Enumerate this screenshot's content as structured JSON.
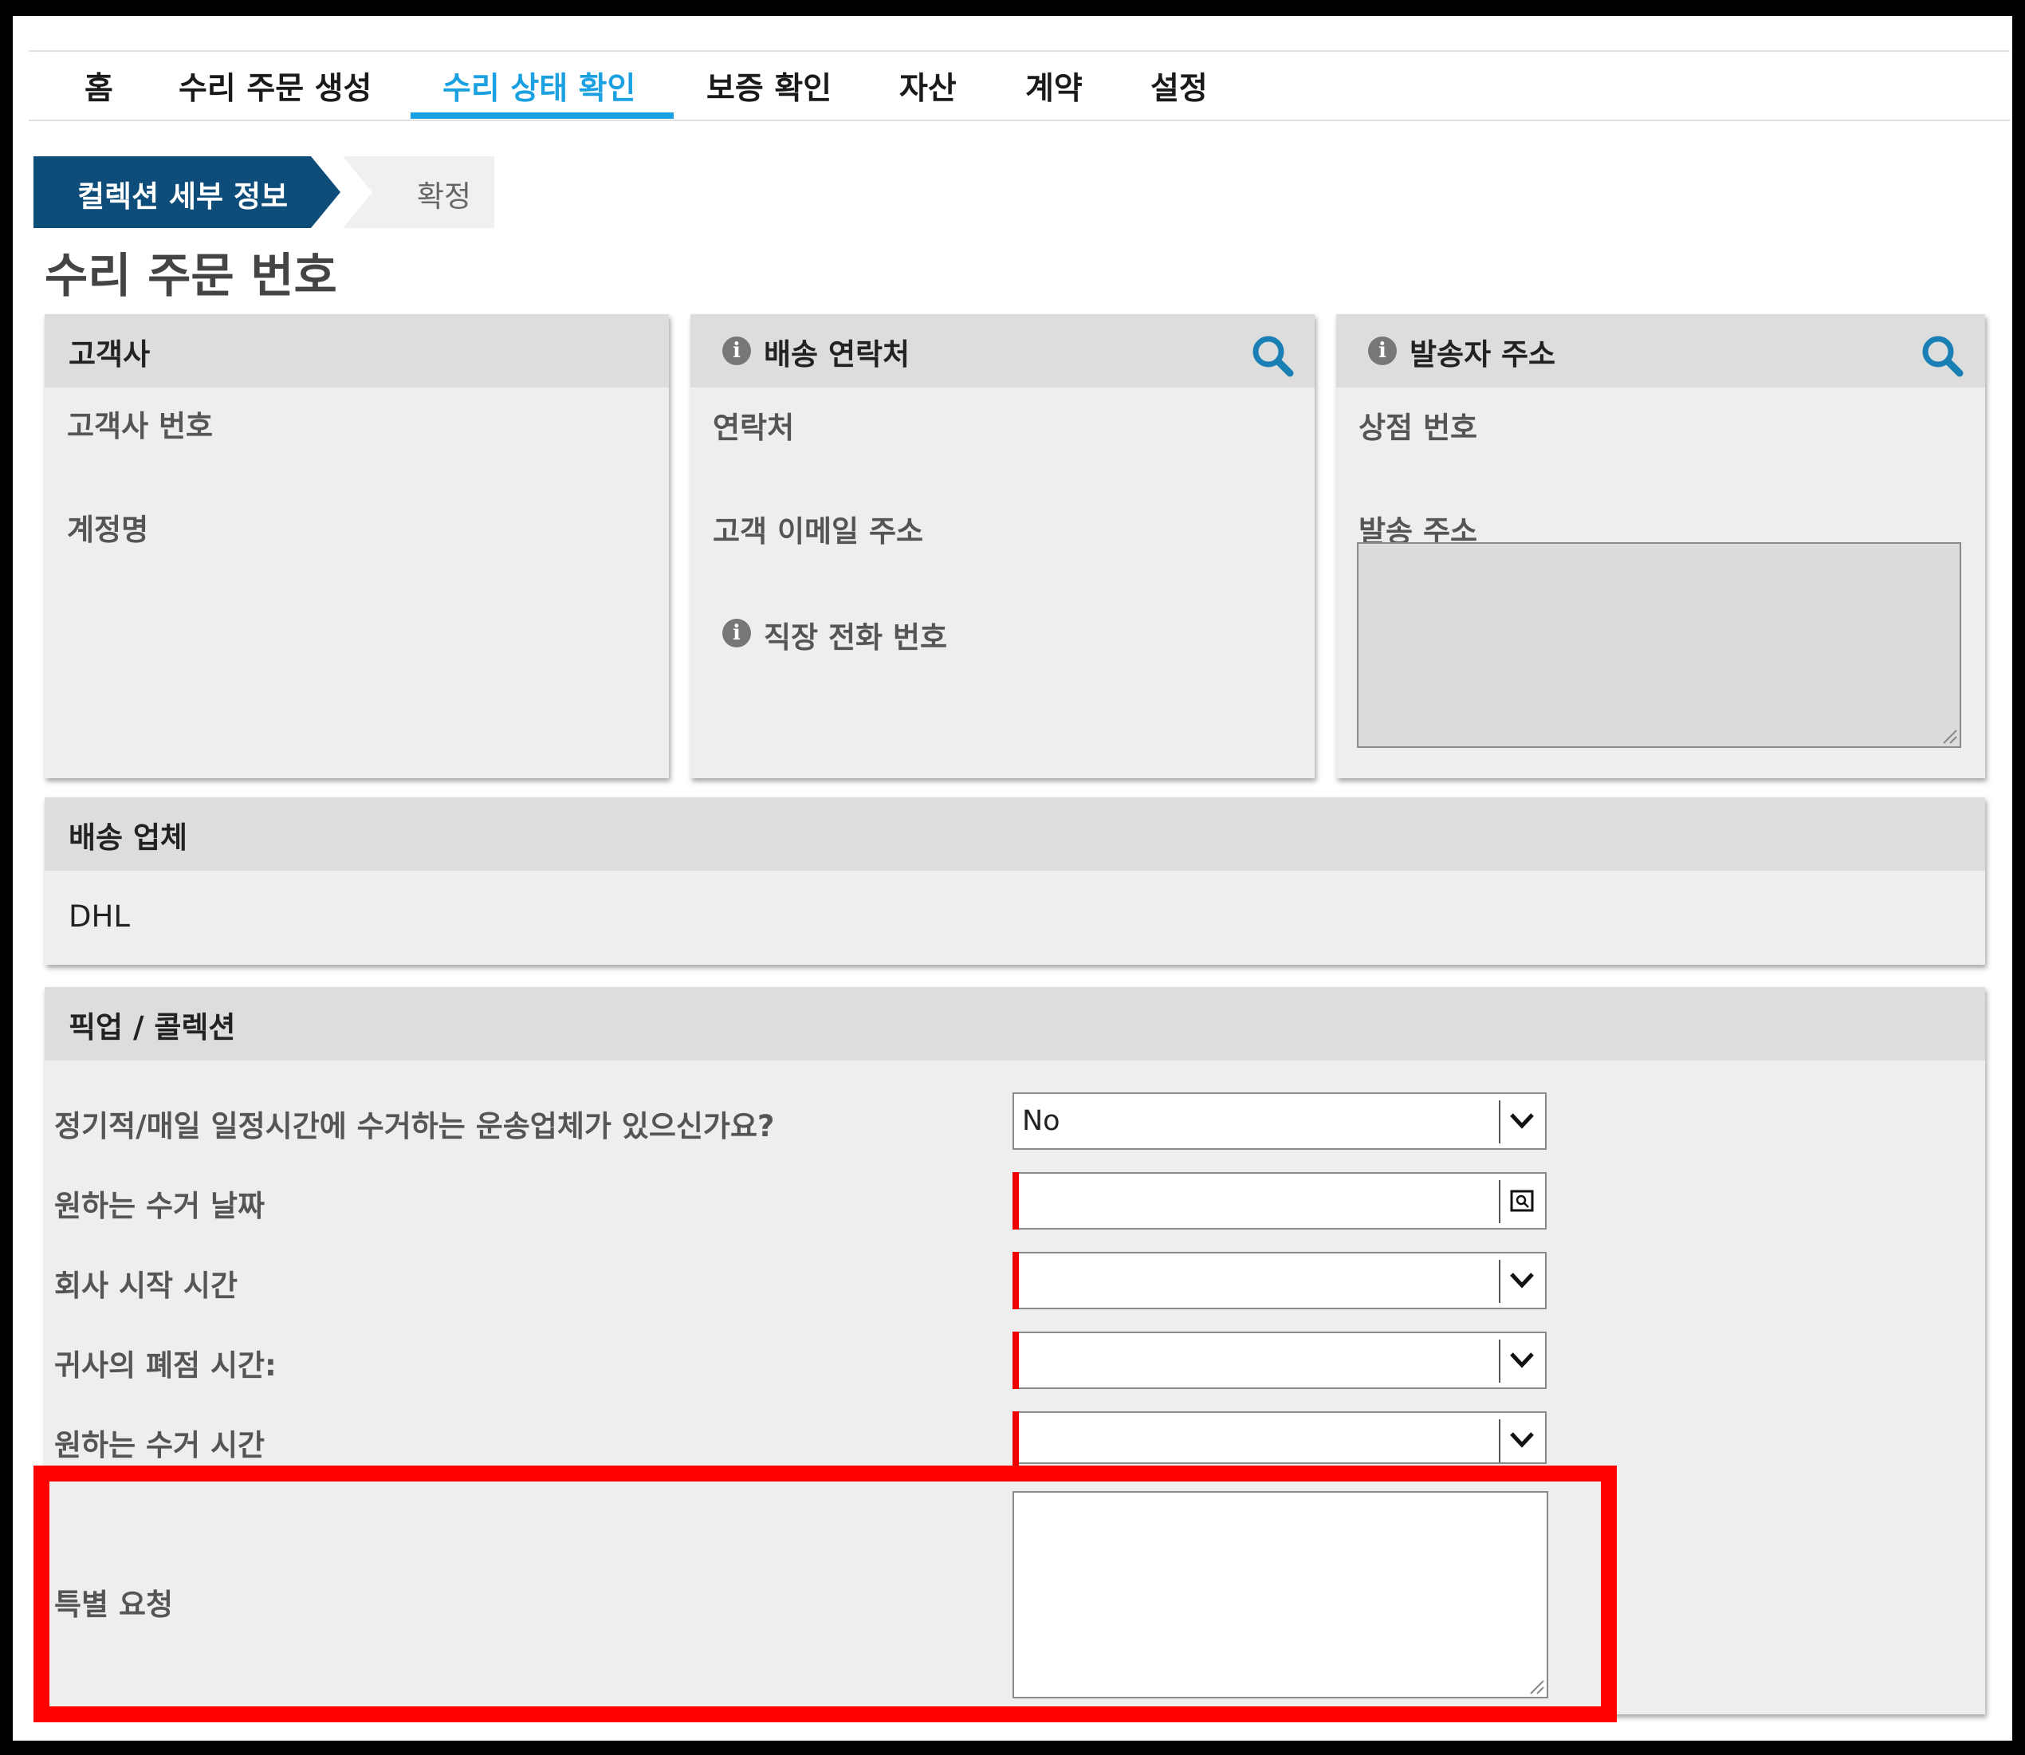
{
  "nav": {
    "items": [
      "홈",
      "수리 주문 생성",
      "수리 상태 확인",
      "보증 확인",
      "자산",
      "계약",
      "설정"
    ],
    "active": "수리 상태 확인"
  },
  "steps": [
    "컬렉션 세부 정보",
    "확정"
  ],
  "page_title": "수리 주문 번호",
  "customer": {
    "title": "고객사",
    "customer_number_label": "고객사 번호",
    "account_name_label": "계정명"
  },
  "ship_contact": {
    "title": "배송 연락처",
    "contact_label": "연락처",
    "email_label": "고객 이메일 주소",
    "work_phone_label": "직장 전화 번호"
  },
  "sender_address": {
    "title": "발송자 주소",
    "store_number_label": "상점 번호",
    "ship_address_label": "발송 주소"
  },
  "carrier": {
    "title": "배송 업체",
    "value": "DHL"
  },
  "pickup": {
    "title": "픽업 / 콜렉션",
    "scheduled_carrier_label": "정기적/매일 일정시간에 수거하는 운송업체가 있으신가요?",
    "scheduled_carrier_value": "No",
    "pickup_date_label": "원하는 수거 날짜",
    "open_time_label": "회사 시작 시간",
    "close_time_label": "귀사의 폐점 시간:",
    "pickup_time_label": "원하는 수거 시간",
    "special_request_label": "특별 요청"
  },
  "colors": {
    "accent": "#1ba1e2",
    "step_active": "#0e4d7a",
    "required": "#e00000",
    "highlight": "#ff0000",
    "search_icon": "#1a7fb5"
  }
}
